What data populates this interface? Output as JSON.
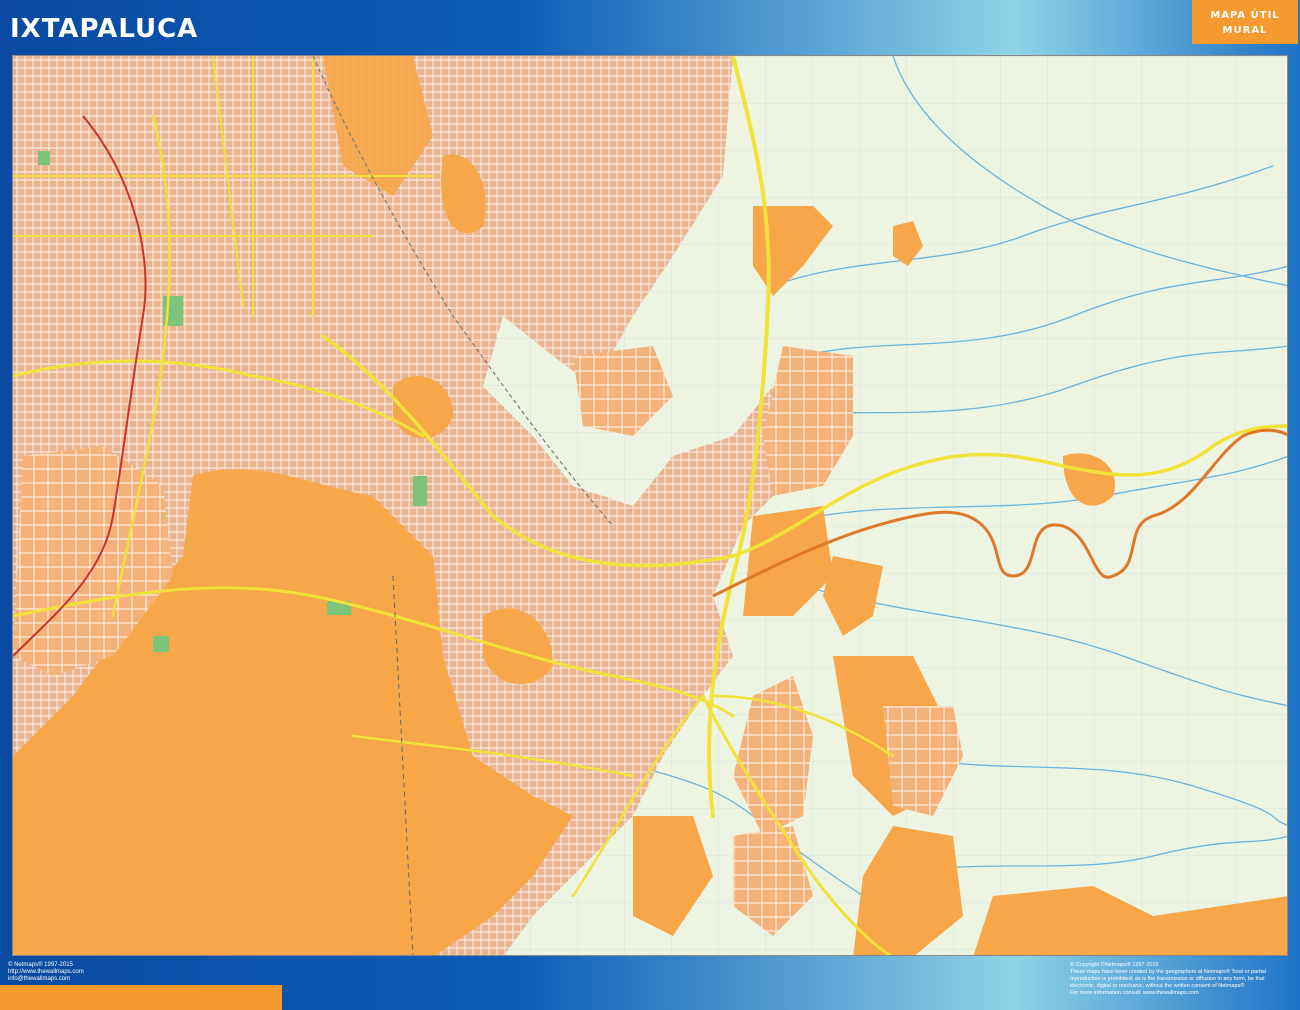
{
  "header": {
    "title": "IXTAPALUCA",
    "badge_line1": "MAPA ÚTIL",
    "badge_line2": "MURAL"
  },
  "colors": {
    "frame_blue": "#0a4e9e",
    "accent_orange": "#f59a2e",
    "urban_orange": "#f7a64a",
    "land_green": "#eef4e2",
    "highway_yellow": "#f1e23a",
    "toll_road_orange": "#e0782a",
    "rail_red": "#c83232",
    "river_blue": "#69b3dc",
    "park_green": "#7cc47a"
  },
  "footer": {
    "left_lines": [
      "© Netmaps® 1997-2015",
      "http://www.thewallmaps.com",
      "info@thewallmaps.com"
    ],
    "right_lines": [
      "© Copyright ©Netmaps® 1997-2015",
      "These maps have been created by the geographers at Netmaps® Total or partial",
      "reproduction is prohibited; as is the transmission or diffusion in any form, be that",
      "electronic, digital or mechanic; without the written consent of Netmaps®",
      "For more information consult: www.thewallmaps.com"
    ]
  }
}
